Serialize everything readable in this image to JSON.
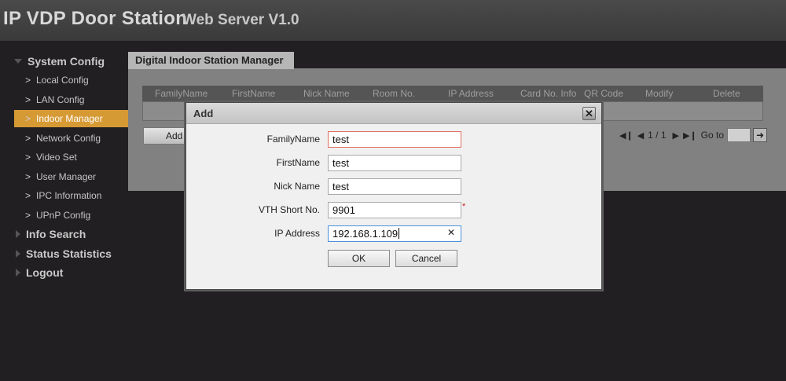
{
  "header": {
    "title": "IP VDP Door Station",
    "subtitle": "Web Server V1.0"
  },
  "sidebar": {
    "sections": [
      {
        "label": "System Config",
        "expanded": true
      },
      {
        "label": "Info Search",
        "expanded": false
      },
      {
        "label": "Status Statistics",
        "expanded": false
      },
      {
        "label": "Logout",
        "expanded": false
      }
    ],
    "items": [
      {
        "label": "Local Config"
      },
      {
        "label": "LAN Config"
      },
      {
        "label": "Indoor Manager",
        "active": true
      },
      {
        "label": "Network Config"
      },
      {
        "label": "Video Set"
      },
      {
        "label": "User Manager"
      },
      {
        "label": "IPC Information"
      },
      {
        "label": "UPnP Config"
      }
    ]
  },
  "main": {
    "tab_label": "Digital Indoor Station Manager",
    "columns": [
      "FamilyName",
      "FirstName",
      "Nick Name",
      "Room No.",
      "IP Address",
      "Card No. Info",
      "QR Code",
      "Modify",
      "Delete"
    ],
    "add_label": "Add",
    "pager": {
      "page_text": "1 / 1",
      "goto_label": "Go to",
      "goto_value": ""
    }
  },
  "dialog": {
    "title": "Add",
    "fields": [
      {
        "label": "FamilyName",
        "value": "test"
      },
      {
        "label": "FirstName",
        "value": "test"
      },
      {
        "label": "Nick Name",
        "value": "test"
      },
      {
        "label": "VTH Short No.",
        "value": "9901",
        "required_mark": "*"
      },
      {
        "label": "IP Address",
        "value": "192.168.1.109"
      }
    ],
    "ok_label": "OK",
    "cancel_label": "Cancel"
  },
  "colors": {
    "accent": "#d69a35",
    "background": "#211f21",
    "panel": "#818181"
  },
  "icons": [
    "first-page-icon",
    "prev-page-icon",
    "next-page-icon",
    "last-page-icon",
    "go-arrow-icon",
    "close-icon",
    "clear-icon",
    "chevron-right-icon",
    "triangle-icon"
  ]
}
